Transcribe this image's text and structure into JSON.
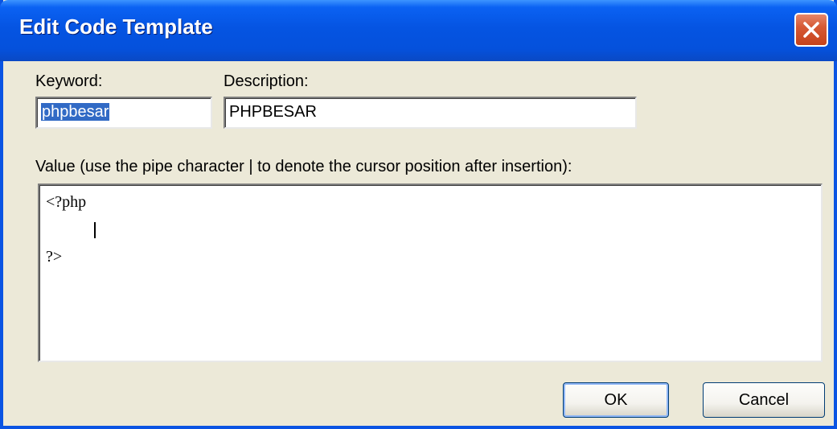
{
  "window": {
    "title": "Edit Code Template",
    "close_icon": "close-icon"
  },
  "keyword": {
    "label": "Keyword:",
    "value": "phpbesar"
  },
  "description": {
    "label": "Description:",
    "value": "PHPBESAR"
  },
  "value_area": {
    "label": "Value (use the pipe character | to denote the cursor position after insertion):",
    "lines": [
      "<?php",
      "",
      "?>"
    ]
  },
  "buttons": {
    "ok": "OK",
    "cancel": "Cancel"
  }
}
